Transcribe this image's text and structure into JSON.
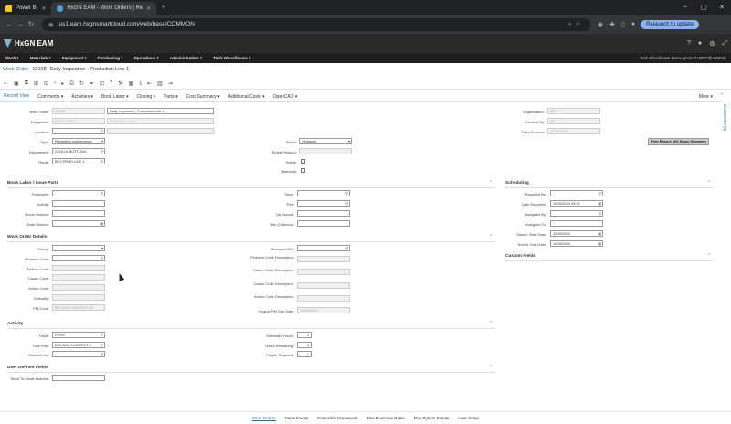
{
  "browser": {
    "tabs": [
      {
        "label": "Power BI"
      },
      {
        "label": "HxGN EAM - Work Orders | Re"
      }
    ],
    "url": "us1.eam.hxgnsmartcloud.com/web/base/COMMON",
    "relaunch": "Relaunch to update"
  },
  "app": {
    "logo": "HxGN EAM",
    "menu": [
      "Work",
      "Materials",
      "Equipment",
      "Purchasing",
      "Operations",
      "Administration",
      "Tech Wheelhouse"
    ],
    "user": "Tech Wheelhouse Demo (JACK.THORP@ADMIN)"
  },
  "breadcrumb": {
    "label": "Work Order",
    "id": "10108",
    "desc": "Daily Inspection - Production Line 1"
  },
  "tabs": [
    "Record View",
    "Comments",
    "Activities",
    "Book Labor",
    "Closing",
    "Parts",
    "Cost Summary",
    "Additional Costs",
    "OpenCAD"
  ],
  "more": "More",
  "sidebar_label": "Documents (0)",
  "header": {
    "work_order_label": "Work Order:",
    "work_order": "10108",
    "work_order_desc": "Daily Inspection - Production Line 1",
    "equipment_label": "Equipment:",
    "equipment": "PROD-LINE-1",
    "equipment_desc": "Production Line 1",
    "location_label": "Location:",
    "type_label": "Type:",
    "type": "Preventive maintenance",
    "department_label": "Department:",
    "department": "G-VILLE-BOTTLING",
    "route_label": "Route:",
    "route": "BEV-PROD-LINE-1",
    "status_label": "Status:",
    "status": "Released",
    "reject_label": "Reject Reason:",
    "safety_label": "Safety:",
    "warranty_label": "Warranty:",
    "org_label": "Organization:",
    "org": "BEV",
    "created_by_label": "Created By:",
    "created_by": "R8",
    "date_created_label": "Date Created:",
    "date_created": "10/28/2024",
    "print_btn": "Print Report: WO Route Summary"
  },
  "book_labor": {
    "title": "Book Labor / Issue Parts",
    "employee": "Employee:",
    "activity": "Activity:",
    "hours": "Hours Worked:",
    "date": "Date Worked:",
    "store": "Store:",
    "part": "Part:",
    "qty": "Qty Issued:",
    "bin": "Bin (Optional):"
  },
  "scheduling": {
    "title": "Scheduling",
    "reported_by": "Reported By:",
    "date_reported_label": "Date Reported:",
    "date_reported": "10/28/2024 03:02",
    "assigned_by": "Assigned By:",
    "assigned_to": "Assigned To:",
    "start_label": "Sched. Start Date:",
    "start": "10/28/2024",
    "end_label": "Sched. End Date:",
    "end": "10/28/2024"
  },
  "details": {
    "title": "Work Order Details",
    "priority": "Priority:",
    "problem": "Problem Code:",
    "failure": "Failure Code:",
    "cause": "Cause Code:",
    "action": "Action Code:",
    "criticality": "Criticality:",
    "pm_label": "PM Code:",
    "pm": "BEV-DAILY-INSPECT-01",
    "std_wo": "Standard WO:",
    "problem_desc": "Problem Code Description:",
    "failure_desc": "Failure Code Description:",
    "cause_desc": "Cause Code Description:",
    "action_desc": "Action Code Description:",
    "orig_pm_label": "Original PM Due Date:",
    "orig_pm": "10/28/2024"
  },
  "custom": {
    "title": "Custom Fields"
  },
  "activity": {
    "title": "Activity",
    "trade_label": "Trade:",
    "trade": "OPER",
    "task_label": "Task Plan:",
    "task": "BEV-DAILY-INSPECT-0",
    "material_label": "Material List:",
    "est_label": "Estimated Hours:",
    "est": "1",
    "rem_label": "Hours Remaining:",
    "rem": "1",
    "people_label": "People Required:",
    "people": "1"
  },
  "udf": {
    "title": "User Defined Fields",
    "email_label": "Send To Email Address:"
  },
  "footer": [
    "Work Orders",
    "Departments",
    "Extensible Framework",
    "Flex Business Rules",
    "Flex Python Events",
    "User Setup"
  ]
}
